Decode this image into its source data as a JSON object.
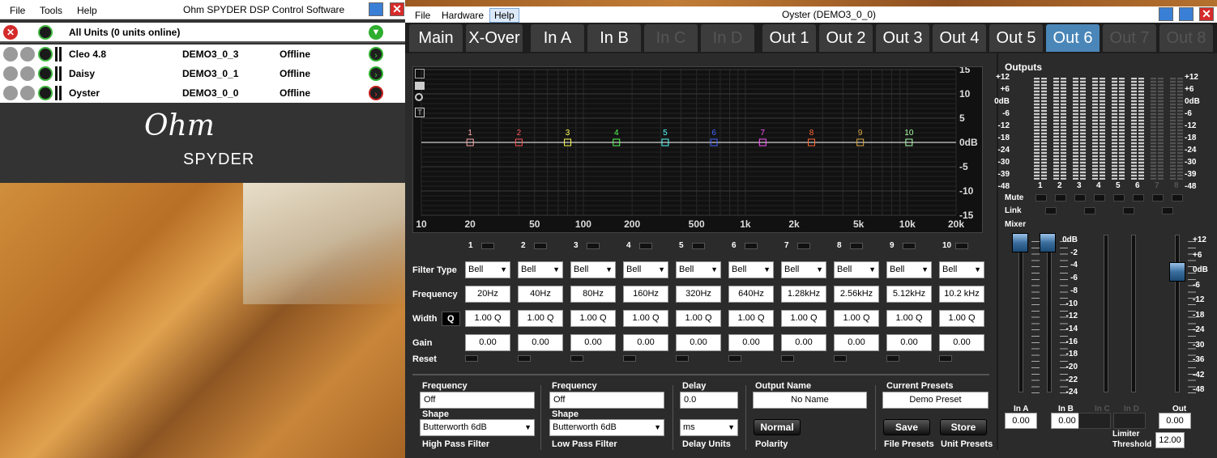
{
  "left_window": {
    "menu": [
      "File",
      "Tools",
      "Help"
    ],
    "title": "Ohm SPYDER DSP Control Software",
    "all_units": "All Units (0 units online)",
    "units": [
      {
        "name": "Cleo 4.8",
        "id": "DEMO3_0_3",
        "status": "Offline"
      },
      {
        "name": "Daisy",
        "id": "DEMO3_0_1",
        "status": "Offline"
      },
      {
        "name": "Oyster",
        "id": "DEMO3_0_0",
        "status": "Offline"
      }
    ],
    "logo_script": "Ohm",
    "logo_text": "SPYDER"
  },
  "right_window": {
    "menu": [
      "File",
      "Hardware",
      "Help"
    ],
    "title": "Oyster (DEMO3_0_0)",
    "tabs": [
      "Main",
      "X-Over",
      "In A",
      "In B",
      "In C",
      "In D",
      "Out 1",
      "Out 2",
      "Out 3",
      "Out 4",
      "Out 5",
      "Out 6",
      "Out 7",
      "Out 8"
    ],
    "active_tab": "Out 6"
  },
  "graph": {
    "y_ticks": [
      "15",
      "10",
      "5",
      "0dB",
      "-5",
      "-10",
      "-15"
    ],
    "x_ticks": [
      "10",
      "20",
      "50",
      "100",
      "200",
      "500",
      "1k",
      "2k",
      "5k",
      "10k",
      "20k"
    ],
    "points": [
      "1",
      "2",
      "3",
      "4",
      "5",
      "6",
      "7",
      "8",
      "9",
      "10"
    ],
    "point_colors": [
      "#ffaaaa",
      "#ff5555",
      "#ffff55",
      "#55ff55",
      "#55ffff",
      "#4466ff",
      "#ff55ff",
      "#ff6633",
      "#ddaa44",
      "#aaffaa"
    ]
  },
  "filters": {
    "labels": {
      "type": "Filter Type",
      "freq": "Frequency",
      "width": "Width",
      "width_mode": "Q",
      "gain": "Gain",
      "reset": "Reset"
    },
    "bands": [
      {
        "n": "1",
        "type": "Bell",
        "freq": "20Hz",
        "q": "1.00 Q",
        "gain": "0.00"
      },
      {
        "n": "2",
        "type": "Bell",
        "freq": "40Hz",
        "q": "1.00 Q",
        "gain": "0.00"
      },
      {
        "n": "3",
        "type": "Bell",
        "freq": "80Hz",
        "q": "1.00 Q",
        "gain": "0.00"
      },
      {
        "n": "4",
        "type": "Bell",
        "freq": "160Hz",
        "q": "1.00 Q",
        "gain": "0.00"
      },
      {
        "n": "5",
        "type": "Bell",
        "freq": "320Hz",
        "q": "1.00 Q",
        "gain": "0.00"
      },
      {
        "n": "6",
        "type": "Bell",
        "freq": "640Hz",
        "q": "1.00 Q",
        "gain": "0.00"
      },
      {
        "n": "7",
        "type": "Bell",
        "freq": "1.28kHz",
        "q": "1.00 Q",
        "gain": "0.00"
      },
      {
        "n": "8",
        "type": "Bell",
        "freq": "2.56kHz",
        "q": "1.00 Q",
        "gain": "0.00"
      },
      {
        "n": "9",
        "type": "Bell",
        "freq": "5.12kHz",
        "q": "1.00 Q",
        "gain": "0.00"
      },
      {
        "n": "10",
        "type": "Bell",
        "freq": "10.2 kHz",
        "q": "1.00 Q",
        "gain": "0.00"
      }
    ]
  },
  "bottom": {
    "hp": {
      "freq_label": "Frequency",
      "freq": "Off",
      "shape_label": "Shape",
      "shape": "Butterworth 6dB",
      "title": "High Pass Filter"
    },
    "lp": {
      "freq_label": "Frequency",
      "freq": "Off",
      "shape_label": "Shape",
      "shape": "Butterworth 6dB",
      "title": "Low Pass Filter"
    },
    "delay": {
      "label": "Delay",
      "value": "0.0",
      "units": "ms",
      "title": "Delay Units"
    },
    "output": {
      "label": "Output Name",
      "value": "No Name",
      "polarity_btn": "Normal",
      "polarity": "Polarity"
    },
    "presets": {
      "label": "Current Presets",
      "value": "Demo Preset",
      "save": "Save",
      "store": "Store",
      "file": "File Presets",
      "unit": "Unit Presets"
    }
  },
  "outputs": {
    "title": "Outputs",
    "scale": [
      "+12",
      "+6",
      "0dB",
      "-6",
      "-12",
      "-18",
      "-24",
      "-30",
      "-39",
      "-48"
    ],
    "channels": [
      "1",
      "2",
      "3",
      "4",
      "5",
      "6",
      "7",
      "8"
    ],
    "mute": "Mute",
    "link": "Link",
    "mixer": "Mixer",
    "mixer_scale": [
      "0dB",
      "-2",
      "-4",
      "-6",
      "-8",
      "-10",
      "-12",
      "-14",
      "-16",
      "-18",
      "-20",
      "-22",
      "-24"
    ],
    "out_scale": [
      "+12",
      "+6",
      "0dB",
      "-6",
      "-12",
      "-18",
      "-24",
      "-30",
      "-36",
      "-42",
      "-48"
    ],
    "mix_labels": [
      "In A",
      "In B",
      "In C",
      "In D",
      "Out"
    ],
    "mix_values": [
      "0.00",
      "0.00",
      "",
      "",
      "0.00"
    ],
    "limiter": "Limiter",
    "threshold": "Threshold",
    "limiter_value": "12.00"
  }
}
